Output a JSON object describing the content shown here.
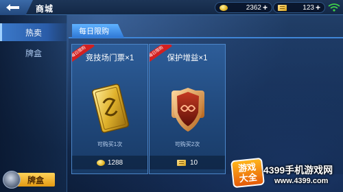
{
  "header": {
    "title": "商城",
    "currencies": [
      {
        "icon": "gold-coin-icon",
        "value": "2362"
      },
      {
        "icon": "ticket-icon",
        "value": "123"
      }
    ],
    "plus": "+"
  },
  "sidebar": {
    "items": [
      {
        "label": "热卖",
        "active": true
      },
      {
        "label": "牌盒",
        "active": false
      }
    ],
    "bottom_button": "牌盒"
  },
  "main": {
    "tab": "每日限购",
    "items": [
      {
        "badge": "每日限购",
        "name": "竞技场门票×1",
        "limit": "可购买1次",
        "price": "1288",
        "price_icon": "gold-coin-icon",
        "art": "gold-ticket-card"
      },
      {
        "badge": "每日限购",
        "name": "保护增益×1",
        "limit": "可购买2次",
        "price": "10",
        "price_icon": "ticket-icon",
        "art": "shield-badge"
      }
    ]
  },
  "watermark": {
    "logo": [
      "游戏",
      "大全"
    ],
    "name": "4399手机游戏网",
    "url": "www.4399.com"
  },
  "colors": {
    "accent": "#3f86d8",
    "gold": "#e2b323",
    "badge_red": "#d32020"
  }
}
